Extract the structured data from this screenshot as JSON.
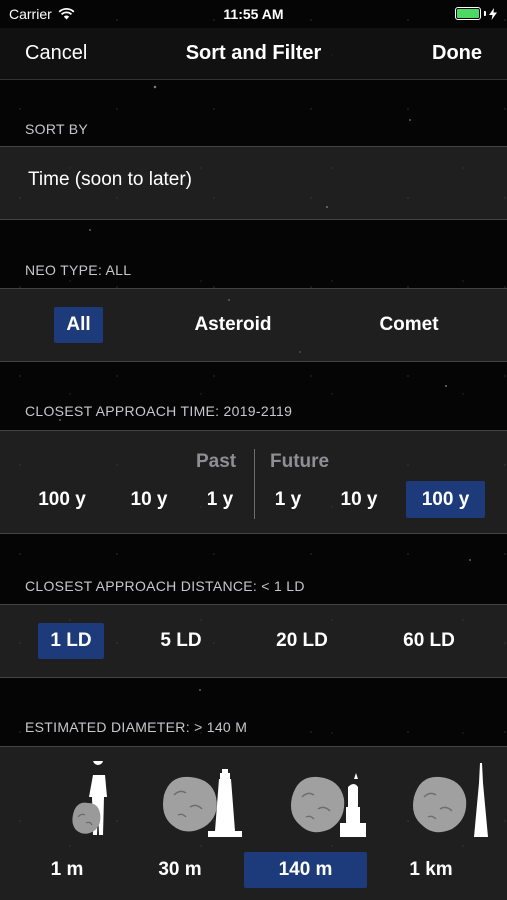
{
  "status_bar": {
    "carrier": "Carrier",
    "time": "11:55 AM"
  },
  "nav": {
    "cancel": "Cancel",
    "title": "Sort and Filter",
    "done": "Done"
  },
  "sort_by": {
    "header": "SORT BY",
    "value": "Time (soon to later)"
  },
  "neo_type": {
    "header": "NEO TYPE: ALL",
    "options": [
      "All",
      "Asteroid",
      "Comet"
    ],
    "selected": "All"
  },
  "approach_time": {
    "header": "CLOSEST APPROACH TIME: 2019-2119",
    "past_label": "Past",
    "future_label": "Future",
    "past_options": [
      "100 y",
      "10 y",
      "1 y"
    ],
    "future_options": [
      "1 y",
      "10 y",
      "100 y"
    ],
    "selected": "100 y (future)"
  },
  "approach_distance": {
    "header": "CLOSEST APPROACH DISTANCE: < 1 LD",
    "options": [
      "1 LD",
      "5 LD",
      "20 LD",
      "60 LD"
    ],
    "selected": "1 LD"
  },
  "diameter": {
    "header": "ESTIMATED DIAMETER: > 140 M",
    "options": [
      "1 m",
      "30 m",
      "140 m",
      "1 km"
    ],
    "selected": "140 m",
    "icons": [
      "asteroid-vs-person-icon",
      "asteroid-vs-lighthouse-icon",
      "asteroid-vs-statue-icon",
      "asteroid-vs-tower-icon"
    ]
  },
  "colors": {
    "accent_selected": "#1d3a7a",
    "battery": "#4cd964"
  }
}
